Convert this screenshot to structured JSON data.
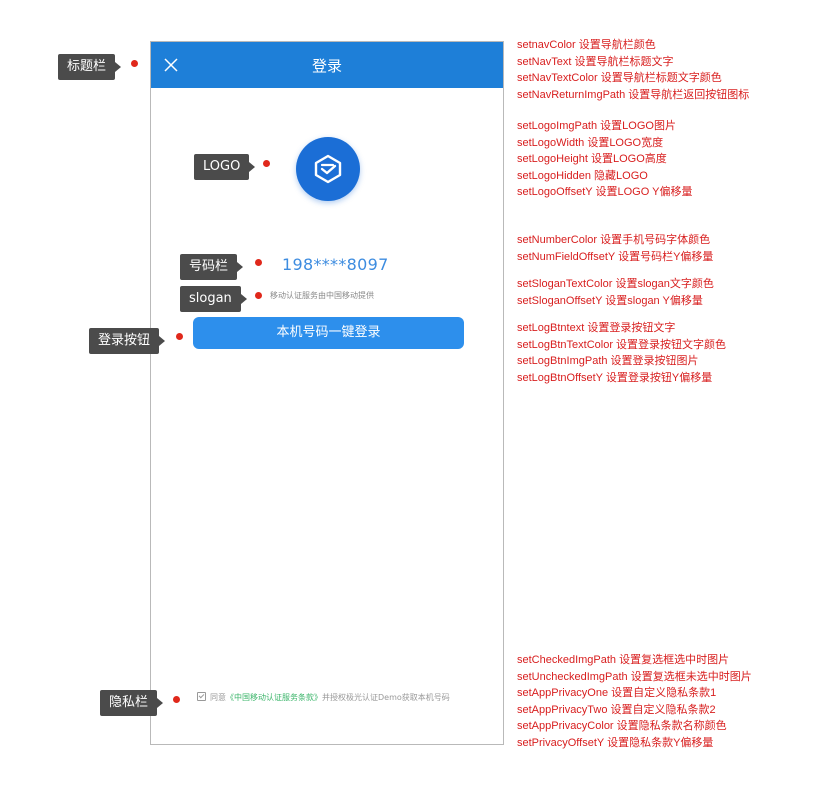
{
  "phone": {
    "nav_title": "登录",
    "number": "198****8097",
    "slogan": "移动认证服务由中国移动提供",
    "login_button": "本机号码一键登录",
    "privacy": {
      "prefix": "同意",
      "link": "《中国移动认证服务条款》",
      "suffix": "并授权极光认证Demo获取本机号码"
    }
  },
  "labels": {
    "title_bar": "标题栏",
    "logo": "LOGO",
    "number_bar": "号码栏",
    "slogan": "slogan",
    "login_button": "登录按钮",
    "privacy_bar": "隐私栏"
  },
  "notes": {
    "nav": [
      "setnavColor 设置导航栏颜色",
      "setNavText 设置导航栏标题文字",
      "setNavTextColor 设置导航栏标题文字颜色",
      "setNavReturnImgPath 设置导航栏返回按钮图标"
    ],
    "logo": [
      "setLogoImgPath 设置LOGO图片",
      "setLogoWidth 设置LOGO宽度",
      "setLogoHeight 设置LOGO高度",
      "setLogoHidden 隐藏LOGO",
      "setLogoOffsetY 设置LOGO Y偏移量"
    ],
    "number": [
      "setNumberColor 设置手机号码字体颜色",
      "setNumFieldOffsetY 设置号码栏Y偏移量"
    ],
    "slogan": [
      "setSloganTextColor 设置slogan文字颜色",
      "setSloganOffsetY 设置slogan Y偏移量"
    ],
    "login": [
      "setLogBtntext 设置登录按钮文字",
      "setLogBtnTextColor 设置登录按钮文字颜色",
      "setLogBtnImgPath 设置登录按钮图片",
      "setLogBtnOffsetY 设置登录按钮Y偏移量"
    ],
    "privacy": [
      "setCheckedImgPath 设置复选框选中时图片",
      "setUncheckedImgPath 设置复选框未选中时图片",
      "setAppPrivacyOne 设置自定义隐私条款1",
      "setAppPrivacyTwo 设置自定义隐私条款2",
      "setAppPrivacyColor 设置隐私条款名称颜色",
      "setPrivacyOffsetY 设置隐私条款Y偏移量"
    ]
  },
  "colors": {
    "nav_background": "#1e7fd8",
    "button_background": "#2d8fec",
    "number_text": "#3d8ce0",
    "privacy_link": "#3bb56a",
    "note_text": "#d81e1e",
    "label_background": "#4b4b4b",
    "dot": "#e0281b"
  },
  "icons": {
    "nav_return": "close-icon",
    "logo": "shield-logo-icon",
    "checkbox": "checkbox-icon"
  }
}
